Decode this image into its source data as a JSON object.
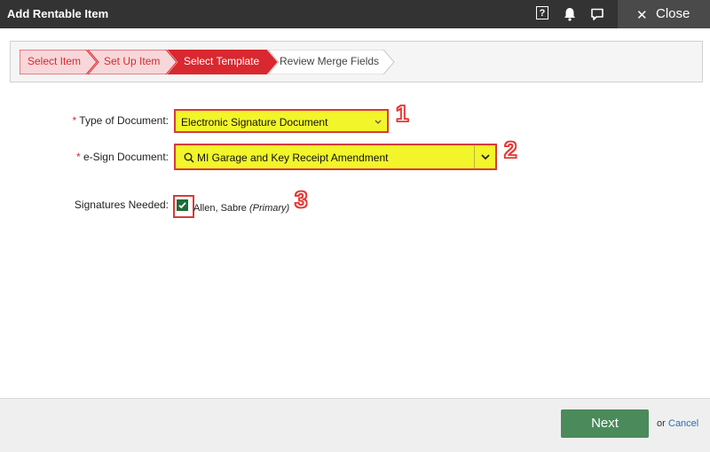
{
  "window": {
    "title": "Add Rentable Item",
    "help_icon": "?",
    "close_label": "Close"
  },
  "wizard": {
    "steps": [
      {
        "label": "Select Item",
        "state": "completed"
      },
      {
        "label": "Set Up Item",
        "state": "completed"
      },
      {
        "label": "Select Template",
        "state": "active"
      },
      {
        "label": "Review Merge Fields",
        "state": "pending"
      }
    ]
  },
  "form": {
    "required_mark": "*",
    "type_of_document": {
      "label": "Type of Document:",
      "value": "Electronic Signature Document"
    },
    "esign_document": {
      "label": "e-Sign Document:",
      "value": "MI Garage and Key Receipt Amendment"
    },
    "signatures_needed": {
      "label": "Signatures Needed:",
      "signer_name": "Allen, Sabre",
      "signer_role": "(Primary)",
      "checked": true
    }
  },
  "annotations": [
    "1",
    "2",
    "3"
  ],
  "footer": {
    "next_label": "Next",
    "or_text": "or",
    "cancel_label": "Cancel"
  },
  "colors": {
    "titlebar": "#333333",
    "step_completed": "#f7d7da",
    "step_active": "#d9282f",
    "highlight": "#f2f52a",
    "annotation_red": "#e53935",
    "next_button": "#4b8a5b",
    "link": "#2a6fb3"
  }
}
